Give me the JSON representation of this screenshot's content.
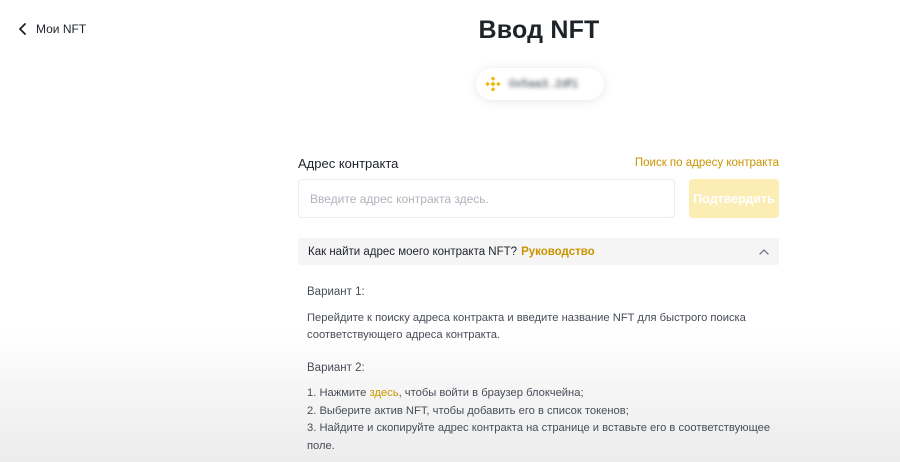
{
  "nav": {
    "back_label": "Мои NFT",
    "back_icon": "chevron-left-icon"
  },
  "page": {
    "title": "Ввод NFT"
  },
  "wallet": {
    "icon": "bnb-coin-icon",
    "address": "0x5aa3..2df1"
  },
  "contract_field": {
    "label": "Адрес контракта",
    "search_link": "Поиск по адресу контракта",
    "placeholder": "Введите адрес контракта здесь.",
    "value": "",
    "confirm_label": "Подтвердить"
  },
  "faq": {
    "question": "Как найти адрес моего контракта NFT?",
    "guide_link": "Руководство",
    "toggle_icon": "chevron-up-icon",
    "variant1": {
      "title": "Вариант 1:",
      "text": "Перейдите к поиску адреса контракта и введите название NFT для быстрого поиска соответствующего адреса контракта."
    },
    "variant2": {
      "title": "Вариант 2:",
      "step1_prefix": "1. Нажмите ",
      "step1_link": "здесь",
      "step1_suffix": ", чтобы войти в браузер блокчейна;",
      "step2": "2. Выберите актив NFT, чтобы добавить его в список токенов;",
      "step3": "3. Найдите и скопируйте адрес контракта на странице и вставьте его в соответствующее поле."
    }
  },
  "colors": {
    "accent": "#c99400",
    "button_disabled_bg": "#fcedb5",
    "bnb": "#f0b90b"
  }
}
